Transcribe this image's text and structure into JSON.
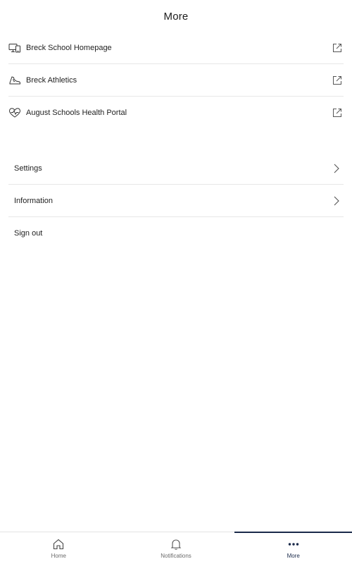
{
  "header": {
    "title": "More"
  },
  "links": [
    {
      "label": "Breck School Homepage",
      "icon": "devices-icon"
    },
    {
      "label": "Breck Athletics",
      "icon": "sneaker-icon"
    },
    {
      "label": "August Schools Health Portal",
      "icon": "heart-pulse-icon"
    }
  ],
  "settings": [
    {
      "label": "Settings",
      "has_chevron": true
    },
    {
      "label": "Information",
      "has_chevron": true
    },
    {
      "label": "Sign out",
      "has_chevron": false
    }
  ],
  "tabs": [
    {
      "label": "Home",
      "icon": "home-icon",
      "active": false
    },
    {
      "label": "Notifications",
      "icon": "bell-icon",
      "active": false
    },
    {
      "label": "More",
      "icon": "more-dots-icon",
      "active": true
    }
  ],
  "colors": {
    "accent": "#1a2a4a",
    "divider": "#e7e7e7",
    "text": "#222222"
  }
}
